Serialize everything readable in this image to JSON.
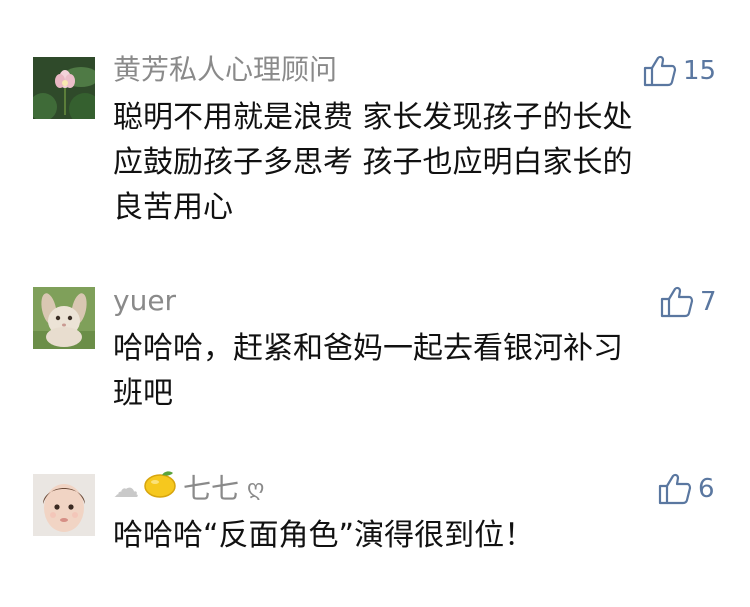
{
  "comments": [
    {
      "author": "黄芳私人心理顾问",
      "likes": "15",
      "lines": [
        "聪明不用就是浪费 家长发现孩子的长处",
        "应鼓励孩子多思考 孩子也应明白家长的",
        "良苦用心"
      ],
      "avatar_icon": "lotus-flower-avatar"
    },
    {
      "author": "yuer",
      "likes": "7",
      "lines": [
        "哈哈哈，赶紧和爸妈一起去看银河补习",
        "班吧"
      ],
      "avatar_icon": "rabbit-avatar"
    },
    {
      "author": "七七",
      "author_prefix_emoji": [
        "☁",
        "🍋"
      ],
      "author_suffix": "ღ",
      "likes": "6",
      "lines": [
        "哈哈哈“反面角色”演得很到位！"
      ],
      "avatar_icon": "baby-photo-avatar"
    }
  ],
  "colors": {
    "name": "#8a8a8a",
    "like": "#5a77a0",
    "text": "#111111"
  }
}
